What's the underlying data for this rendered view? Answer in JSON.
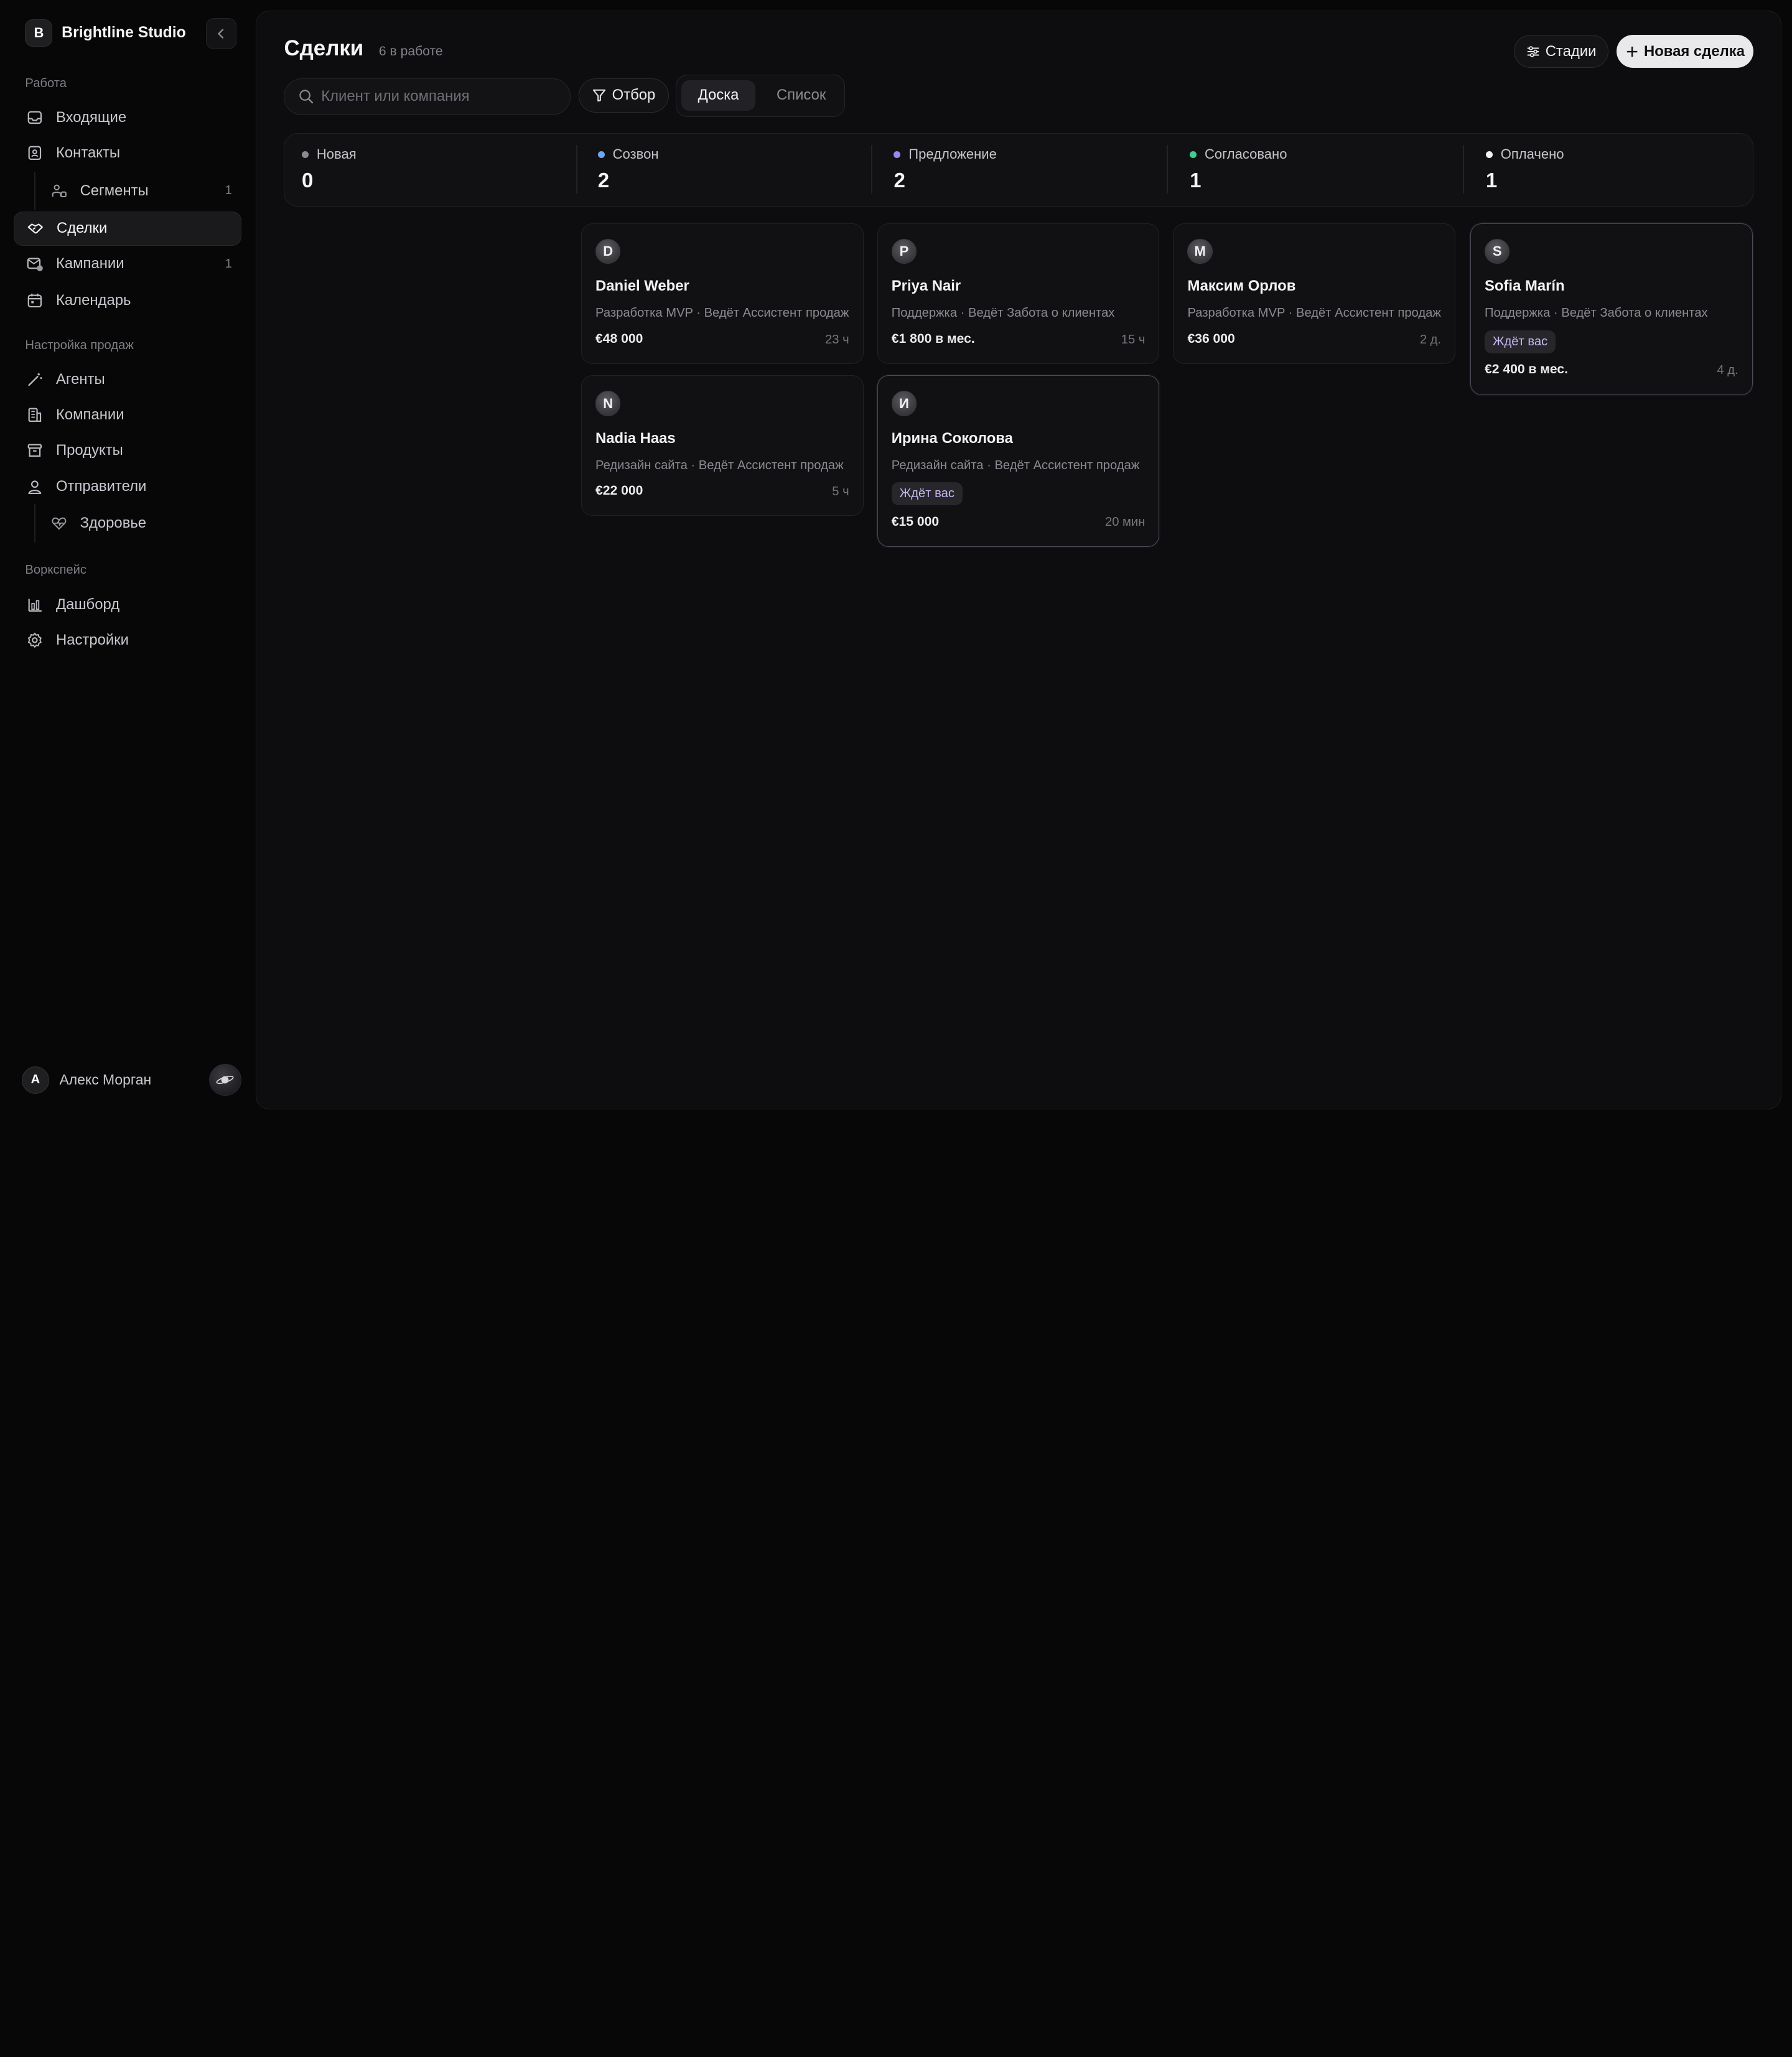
{
  "workspace": {
    "initial": "B",
    "name": "Brightline Studio"
  },
  "sidebar": {
    "sections": [
      {
        "label": "Работа"
      },
      {
        "label": "Настройка продаж"
      },
      {
        "label": "Воркспейс"
      }
    ],
    "items": [
      {
        "label": "Входящие",
        "icon": "inbox-icon"
      },
      {
        "label": "Контакты",
        "icon": "contacts-icon"
      },
      {
        "label": "Сегменты",
        "icon": "segments-icon",
        "count": "1"
      },
      {
        "label": "Сделки",
        "icon": "handshake-icon",
        "active": true
      },
      {
        "label": "Кампании",
        "icon": "campaign-icon",
        "count": "1"
      },
      {
        "label": "Календарь",
        "icon": "calendar-icon"
      },
      {
        "label": "Агенты",
        "icon": "wand-icon"
      },
      {
        "label": "Компании",
        "icon": "building-icon"
      },
      {
        "label": "Продукты",
        "icon": "archive-icon"
      },
      {
        "label": "Отправители",
        "icon": "user-icon"
      },
      {
        "label": "Здоровье",
        "icon": "heart-pulse-icon"
      },
      {
        "label": "Дашборд",
        "icon": "chart-icon"
      },
      {
        "label": "Настройки",
        "icon": "gear-icon"
      }
    ]
  },
  "user": {
    "initial": "А",
    "name": "Алекс Морган"
  },
  "header": {
    "title": "Сделки",
    "subtitle": "6 в работе",
    "stages_label": "Стадии",
    "new_deal_label": "Новая сделка"
  },
  "toolbar": {
    "search_placeholder": "Клиент или компания",
    "filter_label": "Отбор",
    "view_board": "Доска",
    "view_list": "Список"
  },
  "stages": [
    {
      "name": "Новая",
      "count": "0",
      "color": "#8a8a90"
    },
    {
      "name": "Созвон",
      "count": "2",
      "color": "#6aa8f5"
    },
    {
      "name": "Предложение",
      "count": "2",
      "color": "#9a86f0"
    },
    {
      "name": "Согласовано",
      "count": "1",
      "color": "#3ecf8e"
    },
    {
      "name": "Оплачено",
      "count": "1",
      "color": "#f2f2f4"
    }
  ],
  "deals": [
    {
      "initial": "D",
      "name": "Daniel Weber",
      "meta": "Разработка MVP · Ведёт Ассистент продаж",
      "amount": "€48 000",
      "age": "23 ч"
    },
    {
      "initial": "N",
      "name": "Nadia Haas",
      "meta": "Редизайн сайта · Ведёт Ассистент продаж",
      "amount": "€22 000",
      "age": "5 ч"
    },
    {
      "initial": "P",
      "name": "Priya Nair",
      "meta": "Поддержка · Ведёт Забота о клиентах",
      "amount": "€1 800 в мес.",
      "age": "15 ч"
    },
    {
      "initial": "И",
      "name": "Ирина Соколова",
      "meta": "Редизайн сайта · Ведёт Ассистент продаж",
      "badge": "Ждёт вас",
      "amount": "€15 000",
      "age": "20 мин"
    },
    {
      "initial": "М",
      "name": "Максим Орлов",
      "meta": "Разработка MVP · Ведёт Ассистент продаж",
      "amount": "€36 000",
      "age": "2 д."
    },
    {
      "initial": "S",
      "name": "Sofia Marín",
      "meta": "Поддержка · Ведёт Забота о клиентах",
      "badge": "Ждёт вас",
      "amount": "€2 400 в мес.",
      "age": "4 д."
    }
  ]
}
